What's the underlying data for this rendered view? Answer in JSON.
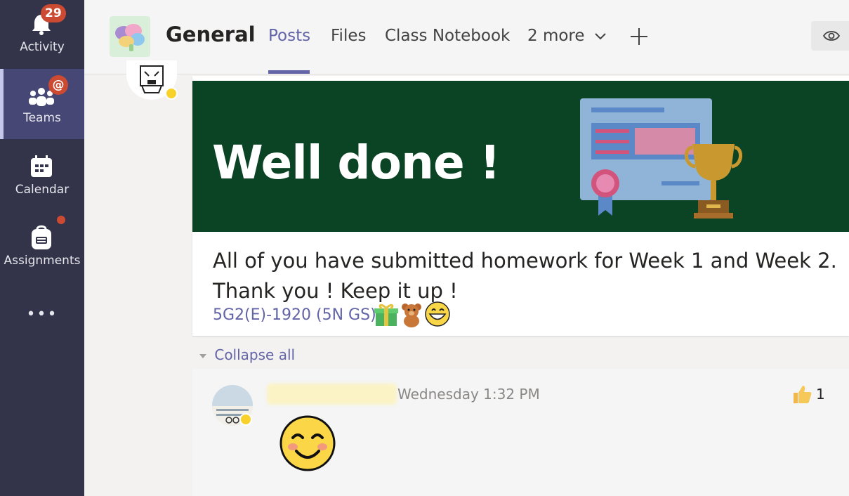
{
  "rail": {
    "activity": {
      "label": "Activity",
      "badge": "29"
    },
    "teams": {
      "label": "Teams",
      "badge": "@"
    },
    "calendar": {
      "label": "Calendar"
    },
    "assignments": {
      "label": "Assignments"
    },
    "more": "•••"
  },
  "header": {
    "channel": "General",
    "tabs": [
      "Posts",
      "Files",
      "Class Notebook",
      "2 more"
    ],
    "active_tab": "Posts"
  },
  "post": {
    "banner_text": "Well done !",
    "message": "All of you have submitted homework for Week 1 and Week 2. Thank you ! Keep it up !",
    "mention": "5G2(E)-1920 (5N GS)"
  },
  "thread": {
    "collapse_label": "Collapse all",
    "reply_time": "Wednesday 1:32 PM",
    "like_count": "1"
  },
  "colors": {
    "rail": "#33344a",
    "accent": "#6264a7",
    "banner": "#0b4425",
    "badge": "#cc4a31"
  }
}
